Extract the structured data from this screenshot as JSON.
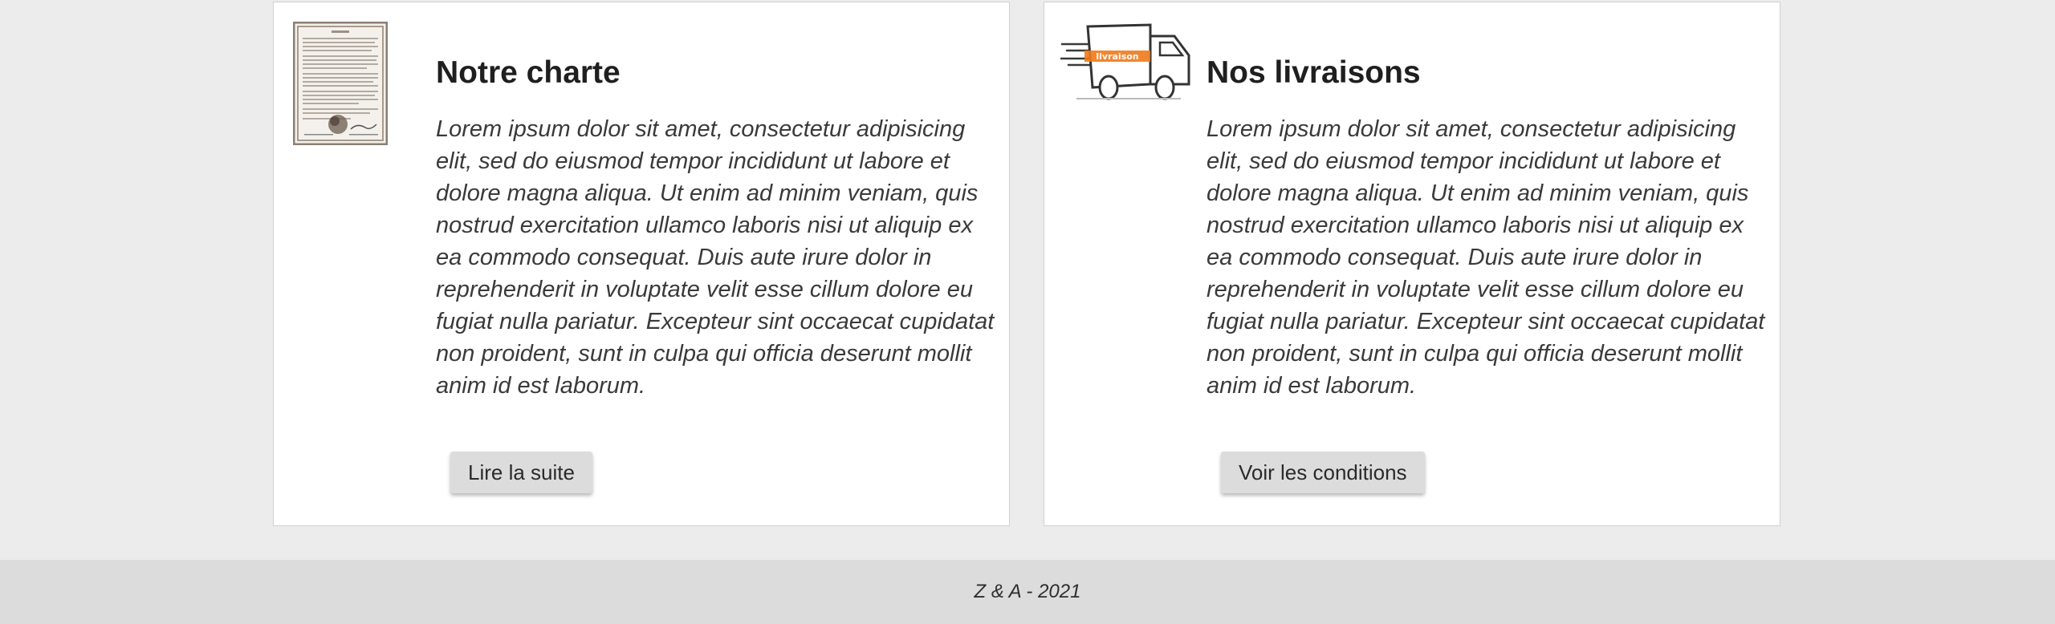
{
  "cards": [
    {
      "title": "Notre charte",
      "text": "Lorem ipsum dolor sit amet, consectetur adipisicing elit, sed do eiusmod tempor incididunt ut labore et dolore magna aliqua. Ut enim ad minim veniam, quis nostrud exercitation ullamco laboris nisi ut aliquip ex ea commodo consequat. Duis aute irure dolor in reprehenderit in voluptate velit esse cillum dolore eu fugiat nulla pariatur. Excepteur sint occaecat cupidatat non proident, sunt in culpa qui officia deserunt mollit anim id est laborum.",
      "button_label": "Lire la suite",
      "icon": "document-icon"
    },
    {
      "title": "Nos livraisons",
      "text": "Lorem ipsum dolor sit amet, consectetur adipisicing elit, sed do eiusmod tempor incididunt ut labore et dolore magna aliqua. Ut enim ad minim veniam, quis nostrud exercitation ullamco laboris nisi ut aliquip ex ea commodo consequat. Duis aute irure dolor in reprehenderit in voluptate velit esse cillum dolore eu fugiat nulla pariatur. Excepteur sint occaecat cupidatat non proident, sunt in culpa qui officia deserunt mollit anim id est laborum.",
      "button_label": "Voir les conditions",
      "icon": "delivery-truck-icon",
      "truck_label": "livraison"
    }
  ],
  "footer": {
    "text": "Z & A - 2021"
  },
  "colors": {
    "page_background": "#ececec",
    "card_background": "#ffffff",
    "button_background": "#dcdcdc",
    "footer_background": "#dcdcdc",
    "truck_accent": "#f07a1a"
  }
}
